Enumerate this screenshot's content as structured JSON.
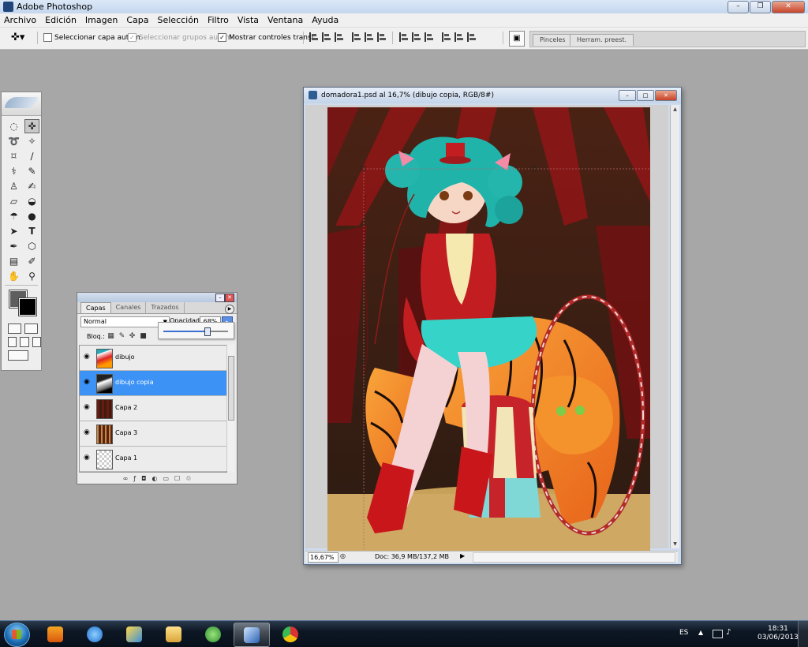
{
  "window": {
    "title": "Adobe Photoshop",
    "buttons": {
      "minimize": "–",
      "maximize": "❐",
      "close": "✕"
    }
  },
  "menu": [
    "Archivo",
    "Edición",
    "Imagen",
    "Capa",
    "Selección",
    "Filtro",
    "Vista",
    "Ventana",
    "Ayuda"
  ],
  "options": {
    "tool_icon": "move-tool-icon",
    "auto_select_layer": {
      "label": "Seleccionar capa autom.",
      "checked": false
    },
    "auto_select_groups": {
      "label": "Seleccionar grupos autom.",
      "checked": true,
      "disabled": true
    },
    "show_transform": {
      "label": "Mostrar controles transf.",
      "checked": true
    },
    "palette_well_tabs": [
      "Pinceles",
      "Herram. preest."
    ]
  },
  "toolbox": {
    "tools": [
      "marquee",
      "move",
      "lasso",
      "magic-wand",
      "crop",
      "slice",
      "healing",
      "brush",
      "clone-stamp",
      "history-brush",
      "eraser",
      "paint-bucket",
      "blur",
      "dodge",
      "path-selection",
      "type",
      "pen",
      "shape",
      "notes",
      "eyedropper",
      "hand",
      "zoom"
    ],
    "foreground_color": "#5e5e5e",
    "background_color": "#000000"
  },
  "layers_panel": {
    "tabs": [
      "Capas",
      "Canales",
      "Trazados"
    ],
    "active_tab": "Capas",
    "blend_mode": "Normal",
    "opacity_label": "Opacidad:",
    "opacity_value": "68%",
    "opacity_fraction": 0.68,
    "lock_label": "Bloq.:",
    "layers": [
      {
        "name": "dibujo",
        "visible": true,
        "selected": false
      },
      {
        "name": "dibujo copia",
        "visible": true,
        "selected": true
      },
      {
        "name": "Capa 2",
        "visible": true,
        "selected": false
      },
      {
        "name": "Capa 3",
        "visible": true,
        "selected": false
      },
      {
        "name": "Capa 1",
        "visible": true,
        "selected": false
      }
    ]
  },
  "document": {
    "title": "domadora1.psd al 16,7% (dibujo copia, RGB/8#)",
    "zoom": "16,67%",
    "doc_info": "Doc: 36,9 MB/137,2 MB"
  },
  "taskbar": {
    "apps": [
      "media-player",
      "internet-explorer",
      "paint",
      "file-explorer",
      "messenger",
      "photoshop",
      "chrome"
    ],
    "active_app": "photoshop",
    "language": "ES",
    "time": "18:31",
    "date": "03/06/2013"
  },
  "colors": {
    "selection_blue": "#3c93f5",
    "workspace_gray": "#a7a7a7"
  }
}
